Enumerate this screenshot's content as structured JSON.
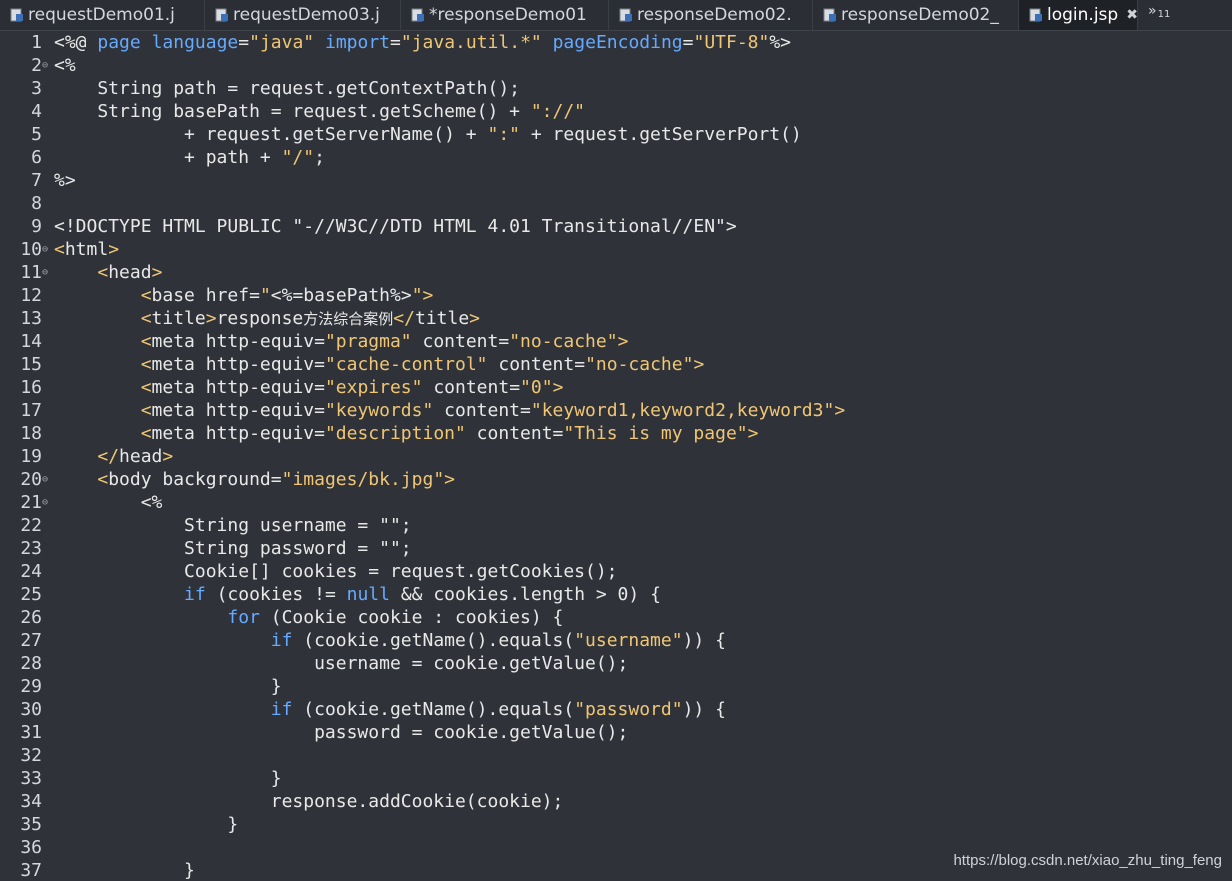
{
  "tabs": [
    {
      "label": "requestDemo01.j",
      "active": false,
      "icon": "jsp-file-icon"
    },
    {
      "label": "requestDemo03.j",
      "active": false,
      "icon": "jsp-file-icon"
    },
    {
      "label": "*responseDemo01",
      "active": false,
      "icon": "jsp-file-icon"
    },
    {
      "label": "responseDemo02.",
      "active": false,
      "icon": "jsp-file-icon"
    },
    {
      "label": "responseDemo02_",
      "active": false,
      "icon": "jsp-file-icon"
    },
    {
      "label": "login.jsp",
      "active": true,
      "icon": "jsp-file-icon",
      "close_glyph": "✖"
    }
  ],
  "tab_overflow": {
    "glyph": "»",
    "count": "11"
  },
  "colors": {
    "background": "#2f3339",
    "text": "#e8e8e8",
    "string": "#f0c674",
    "keyword": "#66aaff",
    "line_number": "#d4d7dc"
  },
  "editor": {
    "lines": [
      {
        "n": "1",
        "fold": "",
        "tokens": [
          [
            "plain",
            "<%@ "
          ],
          [
            "kw2",
            "page"
          ],
          [
            "plain",
            " "
          ],
          [
            "kw2",
            "language"
          ],
          [
            "plain",
            "="
          ],
          [
            "string",
            "\"java\""
          ],
          [
            "plain",
            " "
          ],
          [
            "kw2",
            "import"
          ],
          [
            "plain",
            "="
          ],
          [
            "string",
            "\"java.util.*\""
          ],
          [
            "plain",
            " "
          ],
          [
            "kw2",
            "pageEncoding"
          ],
          [
            "plain",
            "="
          ],
          [
            "string",
            "\"UTF-8\""
          ],
          [
            "plain",
            "%>"
          ]
        ]
      },
      {
        "n": "2",
        "fold": "⊖",
        "tokens": [
          [
            "plain",
            "<%"
          ]
        ]
      },
      {
        "n": "3",
        "fold": "",
        "tokens": [
          [
            "plain",
            "    String path = request.getContextPath();"
          ]
        ]
      },
      {
        "n": "4",
        "fold": "",
        "tokens": [
          [
            "plain",
            "    String basePath = request.getScheme() + "
          ],
          [
            "string",
            "\"://\""
          ]
        ]
      },
      {
        "n": "5",
        "fold": "",
        "tokens": [
          [
            "plain",
            "            + request.getServerName() + "
          ],
          [
            "string",
            "\":\""
          ],
          [
            "plain",
            " + request.getServerPort()"
          ]
        ]
      },
      {
        "n": "6",
        "fold": "",
        "tokens": [
          [
            "plain",
            "            + path + "
          ],
          [
            "string",
            "\"/\""
          ],
          [
            "plain",
            ";"
          ]
        ]
      },
      {
        "n": "7",
        "fold": "",
        "tokens": [
          [
            "plain",
            "%>"
          ]
        ]
      },
      {
        "n": "8",
        "fold": "",
        "tokens": [
          [
            "plain",
            ""
          ]
        ]
      },
      {
        "n": "9",
        "fold": "",
        "tokens": [
          [
            "plain",
            "<!DOCTYPE HTML PUBLIC \"-//W3C//DTD HTML 4.01 Transitional//EN\">"
          ]
        ]
      },
      {
        "n": "10",
        "fold": "⊖",
        "tokens": [
          [
            "tag",
            "<"
          ],
          [
            "tagname",
            "html"
          ],
          [
            "tag",
            ">"
          ]
        ]
      },
      {
        "n": "11",
        "fold": "⊖",
        "tokens": [
          [
            "plain",
            "    "
          ],
          [
            "tag",
            "<"
          ],
          [
            "tagname",
            "head"
          ],
          [
            "tag",
            ">"
          ]
        ]
      },
      {
        "n": "12",
        "fold": "",
        "tokens": [
          [
            "plain",
            "        "
          ],
          [
            "tag",
            "<"
          ],
          [
            "tagname",
            "base"
          ],
          [
            "plain",
            " "
          ],
          [
            "attr",
            "href"
          ],
          [
            "plain",
            "="
          ],
          [
            "string",
            "\""
          ],
          [
            "plain",
            "<%=basePath%>"
          ],
          [
            "string",
            "\">"
          ]
        ]
      },
      {
        "n": "13",
        "fold": "",
        "tokens": [
          [
            "plain",
            "        "
          ],
          [
            "tag",
            "<"
          ],
          [
            "tagname",
            "title"
          ],
          [
            "tag",
            ">"
          ],
          [
            "plain",
            "response"
          ],
          [
            "cjk",
            "方法综合案例"
          ],
          [
            "tag",
            "</"
          ],
          [
            "tagname",
            "title"
          ],
          [
            "tag",
            ">"
          ]
        ]
      },
      {
        "n": "14",
        "fold": "",
        "tokens": [
          [
            "plain",
            "        "
          ],
          [
            "tag",
            "<"
          ],
          [
            "tagname",
            "meta"
          ],
          [
            "plain",
            " http-equiv="
          ],
          [
            "string",
            "\"pragma\""
          ],
          [
            "plain",
            " content="
          ],
          [
            "string",
            "\"no-cache\""
          ],
          [
            "tag",
            ">"
          ]
        ]
      },
      {
        "n": "15",
        "fold": "",
        "tokens": [
          [
            "plain",
            "        "
          ],
          [
            "tag",
            "<"
          ],
          [
            "tagname",
            "meta"
          ],
          [
            "plain",
            " http-equiv="
          ],
          [
            "string",
            "\"cache-control\""
          ],
          [
            "plain",
            " content="
          ],
          [
            "string",
            "\"no-cache\""
          ],
          [
            "tag",
            ">"
          ]
        ]
      },
      {
        "n": "16",
        "fold": "",
        "tokens": [
          [
            "plain",
            "        "
          ],
          [
            "tag",
            "<"
          ],
          [
            "tagname",
            "meta"
          ],
          [
            "plain",
            " http-equiv="
          ],
          [
            "string",
            "\"expires\""
          ],
          [
            "plain",
            " content="
          ],
          [
            "string",
            "\"0\""
          ],
          [
            "tag",
            ">"
          ]
        ]
      },
      {
        "n": "17",
        "fold": "",
        "tokens": [
          [
            "plain",
            "        "
          ],
          [
            "tag",
            "<"
          ],
          [
            "tagname",
            "meta"
          ],
          [
            "plain",
            " http-equiv="
          ],
          [
            "string",
            "\"keywords\""
          ],
          [
            "plain",
            " content="
          ],
          [
            "string",
            "\"keyword1,keyword2,keyword3\""
          ],
          [
            "tag",
            ">"
          ]
        ]
      },
      {
        "n": "18",
        "fold": "",
        "tokens": [
          [
            "plain",
            "        "
          ],
          [
            "tag",
            "<"
          ],
          [
            "tagname",
            "meta"
          ],
          [
            "plain",
            " http-equiv="
          ],
          [
            "string",
            "\"description\""
          ],
          [
            "plain",
            " content="
          ],
          [
            "string",
            "\"This is my page\""
          ],
          [
            "tag",
            ">"
          ]
        ]
      },
      {
        "n": "19",
        "fold": "",
        "tokens": [
          [
            "plain",
            "    "
          ],
          [
            "tag",
            "</"
          ],
          [
            "tagname",
            "head"
          ],
          [
            "tag",
            ">"
          ]
        ]
      },
      {
        "n": "20",
        "fold": "⊖",
        "tokens": [
          [
            "plain",
            "    "
          ],
          [
            "tag",
            "<"
          ],
          [
            "tagname",
            "body"
          ],
          [
            "plain",
            " background="
          ],
          [
            "string",
            "\"images/bk.jpg\""
          ],
          [
            "tag",
            ">"
          ]
        ]
      },
      {
        "n": "21",
        "fold": "⊖",
        "tokens": [
          [
            "plain",
            "        <%"
          ]
        ]
      },
      {
        "n": "22",
        "fold": "",
        "tokens": [
          [
            "plain",
            "            String username = \"\";"
          ]
        ]
      },
      {
        "n": "23",
        "fold": "",
        "tokens": [
          [
            "plain",
            "            String password = \"\";"
          ]
        ]
      },
      {
        "n": "24",
        "fold": "",
        "tokens": [
          [
            "plain",
            "            Cookie[] cookies = request.getCookies();"
          ]
        ]
      },
      {
        "n": "25",
        "fold": "",
        "tokens": [
          [
            "plain",
            "            "
          ],
          [
            "kw2",
            "if"
          ],
          [
            "plain",
            " (cookies != "
          ],
          [
            "kw2",
            "null"
          ],
          [
            "plain",
            " && cookies.length > 0) {"
          ]
        ]
      },
      {
        "n": "26",
        "fold": "",
        "tokens": [
          [
            "plain",
            "                "
          ],
          [
            "kw2",
            "for"
          ],
          [
            "plain",
            " (Cookie cookie : cookies) {"
          ]
        ]
      },
      {
        "n": "27",
        "fold": "",
        "tokens": [
          [
            "plain",
            "                    "
          ],
          [
            "kw2",
            "if"
          ],
          [
            "plain",
            " (cookie.getName().equals("
          ],
          [
            "string",
            "\"username\""
          ],
          [
            "plain",
            ")) {"
          ]
        ]
      },
      {
        "n": "28",
        "fold": "",
        "tokens": [
          [
            "plain",
            "                        username = cookie.getValue();"
          ]
        ]
      },
      {
        "n": "29",
        "fold": "",
        "tokens": [
          [
            "plain",
            "                    }"
          ]
        ]
      },
      {
        "n": "30",
        "fold": "",
        "tokens": [
          [
            "plain",
            "                    "
          ],
          [
            "kw2",
            "if"
          ],
          [
            "plain",
            " (cookie.getName().equals("
          ],
          [
            "string",
            "\"password\""
          ],
          [
            "plain",
            ")) {"
          ]
        ]
      },
      {
        "n": "31",
        "fold": "",
        "tokens": [
          [
            "plain",
            "                        password = cookie.getValue();"
          ]
        ]
      },
      {
        "n": "32",
        "fold": "",
        "tokens": [
          [
            "plain",
            ""
          ]
        ]
      },
      {
        "n": "33",
        "fold": "",
        "tokens": [
          [
            "plain",
            "                    }"
          ]
        ]
      },
      {
        "n": "34",
        "fold": "",
        "tokens": [
          [
            "plain",
            "                    response.addCookie(cookie);"
          ]
        ]
      },
      {
        "n": "35",
        "fold": "",
        "tokens": [
          [
            "plain",
            "                }"
          ]
        ]
      },
      {
        "n": "36",
        "fold": "",
        "tokens": [
          [
            "plain",
            ""
          ]
        ]
      },
      {
        "n": "37",
        "fold": "",
        "tokens": [
          [
            "plain",
            "            }"
          ]
        ]
      }
    ]
  },
  "watermark": "https://blog.csdn.net/xiao_zhu_ting_feng"
}
